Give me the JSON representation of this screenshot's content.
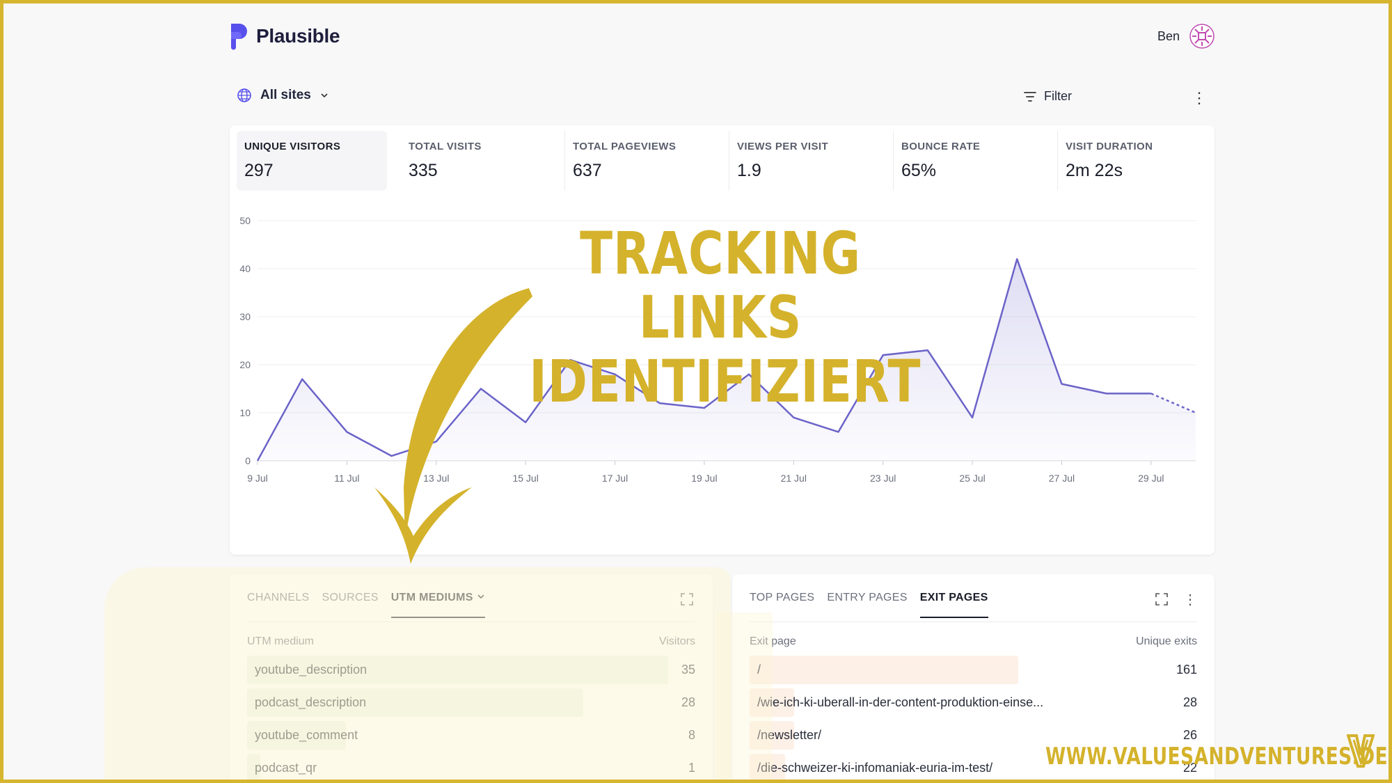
{
  "app": {
    "name": "Plausible"
  },
  "user": {
    "name": "Ben"
  },
  "toolbar": {
    "site_selector": "All sites",
    "filter_label": "Filter"
  },
  "stats": [
    {
      "label": "UNIQUE VISITORS",
      "value": "297"
    },
    {
      "label": "TOTAL VISITS",
      "value": "335"
    },
    {
      "label": "TOTAL PAGEVIEWS",
      "value": "637"
    },
    {
      "label": "VIEWS PER VISIT",
      "value": "1.9"
    },
    {
      "label": "BOUNCE RATE",
      "value": "65%"
    },
    {
      "label": "VISIT DURATION",
      "value": "2m 22s"
    }
  ],
  "chart_data": {
    "type": "area",
    "x": [
      "9 Jul",
      "10 Jul",
      "11 Jul",
      "12 Jul",
      "13 Jul",
      "14 Jul",
      "15 Jul",
      "16 Jul",
      "17 Jul",
      "18 Jul",
      "19 Jul",
      "20 Jul",
      "21 Jul",
      "22 Jul",
      "23 Jul",
      "24 Jul",
      "25 Jul",
      "26 Jul",
      "27 Jul",
      "28 Jul",
      "29 Jul",
      "30 Jul"
    ],
    "series": [
      {
        "values": [
          0,
          17,
          6,
          1,
          4,
          15,
          8,
          21,
          18,
          12,
          11,
          18,
          9,
          6,
          22,
          23,
          9,
          42,
          16,
          14,
          14,
          10
        ]
      }
    ],
    "x_tick_labels": [
      "9 Jul",
      "11 Jul",
      "13 Jul",
      "15 Jul",
      "17 Jul",
      "19 Jul",
      "21 Jul",
      "23 Jul",
      "25 Jul",
      "27 Jul",
      "29 Jul"
    ],
    "y_ticks": [
      "0",
      "10",
      "20",
      "30",
      "40",
      "50"
    ],
    "ylim": [
      0,
      50
    ],
    "dashed_last_segment": true,
    "grid": true,
    "color": "#6b63c8"
  },
  "headline": {
    "line1": "TRACKING LINKS",
    "line2": "IDENTIFIZIERT"
  },
  "sources_panel": {
    "tabs": [
      "CHANNELS",
      "SOURCES",
      "UTM MEDIUMS"
    ],
    "active_tab": "UTM MEDIUMS",
    "col_label": "UTM medium",
    "col_value": "Visitors",
    "rows": [
      {
        "label": "youtube_description",
        "value": "35",
        "share": 0.94
      },
      {
        "label": "podcast_description",
        "value": "28",
        "share": 0.75
      },
      {
        "label": "youtube_comment",
        "value": "8",
        "share": 0.22
      },
      {
        "label": "podcast_qr",
        "value": "1",
        "share": 0.03
      }
    ],
    "bar_color": "#eef3e8"
  },
  "pages_panel": {
    "tabs": [
      "TOP PAGES",
      "ENTRY PAGES",
      "EXIT PAGES"
    ],
    "active_tab": "EXIT PAGES",
    "col_label": "Exit page",
    "col_value": "Unique exits",
    "rows": [
      {
        "label": "/",
        "value": "161",
        "share": 0.6
      },
      {
        "label": "/wie-ich-ki-uberall-in-der-content-produktion-einse...",
        "value": "28",
        "share": 0.1
      },
      {
        "label": "/newsletter/",
        "value": "26",
        "share": 0.1
      },
      {
        "label": "/die-schweizer-ki-infomaniak-euria-im-test/",
        "value": "22",
        "share": 0.08
      }
    ],
    "bar_color": "#fdf0e6"
  },
  "watermark": {
    "text": "WWW.VALUESANDVENTURES.DE"
  },
  "colors": {
    "accent": "#d4b22b",
    "brand": "#5850ec",
    "frame": "#d6b52f"
  }
}
